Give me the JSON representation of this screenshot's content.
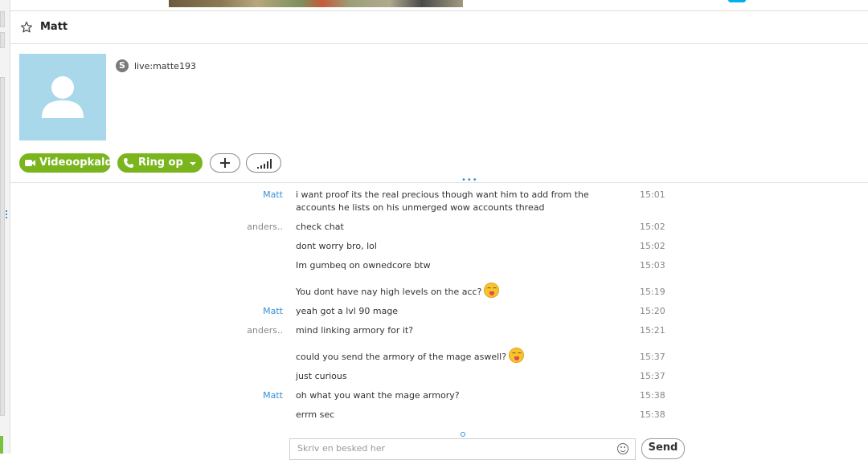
{
  "header": {
    "contact_name": "Matt"
  },
  "profile": {
    "skype_id": "live:matte193"
  },
  "actions": {
    "video_call_label": "Videoopkald",
    "call_label": "Ring op"
  },
  "messages": [
    {
      "sender": "Matt",
      "text": "i want proof its the real precious though want him to add from the accounts he lists on his unmerged wow accounts thread",
      "time": "15:01"
    },
    {
      "sender": "anders..",
      "text": "check chat",
      "time": "15:02"
    },
    {
      "sender": "",
      "text": "dont worry bro, lol",
      "time": "15:02"
    },
    {
      "sender": "",
      "text": "Im gumbeq on ownedcore btw",
      "time": "15:03"
    },
    {
      "sender": "",
      "text": "You dont have nay high levels on the acc?",
      "time": "15:19",
      "emoji": "tongue-emoji"
    },
    {
      "sender": "Matt",
      "text": "yeah got a lvl 90 mage",
      "time": "15:20"
    },
    {
      "sender": "anders..",
      "text": "mind linking armory for it?",
      "time": "15:21"
    },
    {
      "sender": "",
      "text": "could you send the armory of the mage aswell?",
      "time": "15:37",
      "emoji": "tongue-emoji"
    },
    {
      "sender": "",
      "text": "just curious",
      "time": "15:37"
    },
    {
      "sender": "Matt",
      "text": "oh what you want the mage armory?",
      "time": "15:38"
    },
    {
      "sender": "",
      "text": "errm sec",
      "time": "15:38"
    }
  ],
  "composer": {
    "placeholder": "Skriv en besked her",
    "send_label": "Send"
  },
  "colors": {
    "accent_green": "#7ab51d",
    "link_blue": "#3a8fd4",
    "avatar_bg": "#a8d8ea"
  },
  "icons": [
    "star-icon",
    "skype-icon",
    "video-camera-icon",
    "phone-icon",
    "plus-icon",
    "signal-icon",
    "emoticon-icon"
  ]
}
